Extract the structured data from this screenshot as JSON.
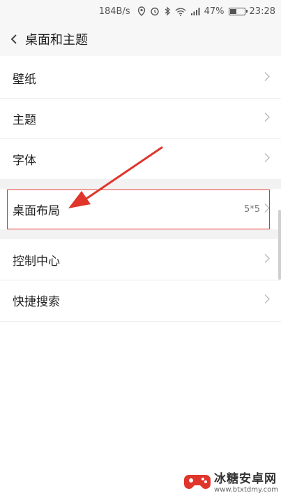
{
  "status_bar": {
    "speed": "184B/s",
    "battery": "47%",
    "battery_level": 0.47,
    "time": "23:28",
    "icons": [
      "alarm-location-icon",
      "alarm-icon",
      "bluetooth-icon",
      "wifi-icon",
      "signal-icon"
    ]
  },
  "header": {
    "title": "桌面和主题",
    "back_icon": "chevron-left-icon"
  },
  "settings": {
    "group1": [
      {
        "label": "壁纸"
      },
      {
        "label": "主题"
      },
      {
        "label": "字体"
      }
    ],
    "desktop_layout": {
      "label": "桌面布局",
      "value": "5*5"
    },
    "group2": [
      {
        "label": "控制中心"
      },
      {
        "label": "快捷搜索"
      }
    ]
  },
  "annotation": {
    "highlight_color": "#e0352b"
  },
  "watermark": {
    "title": "冰糖安卓网",
    "url": "www.btxtdmy.com"
  }
}
